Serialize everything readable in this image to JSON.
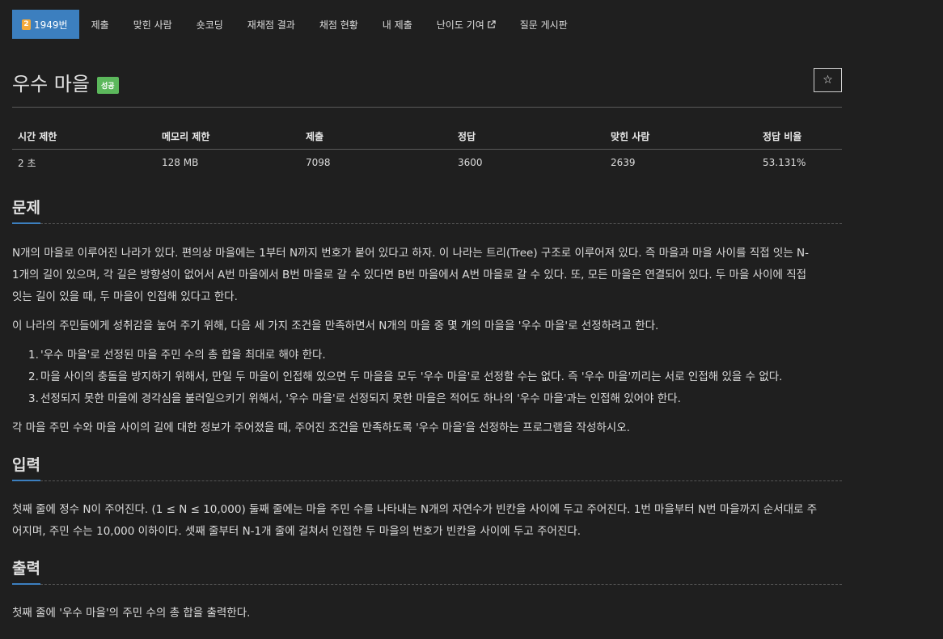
{
  "nav": {
    "problem_no": "1949번",
    "level_badge": "2",
    "items": [
      "제출",
      "맞힌 사람",
      "숏코딩",
      "재채점 결과",
      "채점 현황",
      "내 제출",
      "난이도 기여",
      "질문 게시판"
    ]
  },
  "problem": {
    "title": "우수 마을",
    "result_badge": "성공",
    "star": "☆"
  },
  "stats": {
    "headers": [
      "시간 제한",
      "메모리 제한",
      "제출",
      "정답",
      "맞힌 사람",
      "정답 비율"
    ],
    "values": [
      "2 초",
      "128 MB",
      "7098",
      "3600",
      "2639",
      "53.131%"
    ]
  },
  "sections": {
    "problem_heading": "문제",
    "problem_lines": [
      "N개의 마을로 이루어진 나라가 있다. 편의상 마을에는 1부터 N까지 번호가 붙어 있다고 하자. 이 나라는 트리(Tree) 구조로 이루어져 있다. 즉 마을과 마을 사이를 직접 잇는 N-",
      "1개의 길이 있으며, 각 길은 방향성이 없어서 A번 마을에서 B번 마을로 갈 수 있다면 B번 마을에서 A번 마을로 갈 수 있다. 또, 모든 마을은 연결되어 있다. 두 마을 사이에 직접",
      "잇는 길이 있을 때, 두 마을이 인접해 있다고 한다."
    ],
    "problem_p2": "이 나라의 주민들에게 성취감을 높여 주기 위해, 다음 세 가지 조건을 만족하면서 N개의 마을 중 몇 개의 마을을 '우수 마을'로 선정하려고 한다.",
    "conditions": [
      "'우수 마을'로 선정된 마을 주민 수의 총 합을 최대로 해야 한다.",
      "마을 사이의 충돌을 방지하기 위해서, 만일 두 마을이 인접해 있으면 두 마을을 모두 '우수 마을'로 선정할 수는 없다. 즉 '우수 마을'끼리는 서로 인접해 있을 수 없다.",
      "선정되지 못한 마을에 경각심을 불러일으키기 위해서, '우수 마을'로 선정되지 못한 마을은 적어도 하나의 '우수 마을'과는 인접해 있어야 한다."
    ],
    "condition_numbers": [
      "1.",
      "2.",
      "3."
    ],
    "problem_p3": "각 마을 주민 수와 마을 사이의 길에 대한 정보가 주어졌을 때, 주어진 조건을 만족하도록 '우수 마을'을 선정하는 프로그램을 작성하시오.",
    "input_heading": "입력",
    "input_lines": [
      "첫째 줄에 정수 N이 주어진다. (1 ≤ N ≤ 10,000) 둘째 줄에는 마을 주민 수를 나타내는 N개의 자연수가 빈칸을 사이에 두고 주어진다. 1번 마을부터 N번 마을까지 순서대로 주",
      "어지며, 주민 수는 10,000 이하이다. 셋째 줄부터 N-1개 줄에 걸쳐서 인접한 두 마을의 번호가 빈칸을 사이에 두고 주어진다."
    ],
    "output_heading": "출력",
    "output_text": "첫째 줄에 '우수 마을'의 주민 수의 총 합을 출력한다."
  },
  "icons": {
    "level": "level-badge-icon",
    "external": "external-link-icon",
    "star": "star-icon"
  },
  "colors": {
    "accent": "#3c7fbf",
    "success": "#5cb85c",
    "level": "#f2a93b",
    "background": "#1f1f1f"
  }
}
